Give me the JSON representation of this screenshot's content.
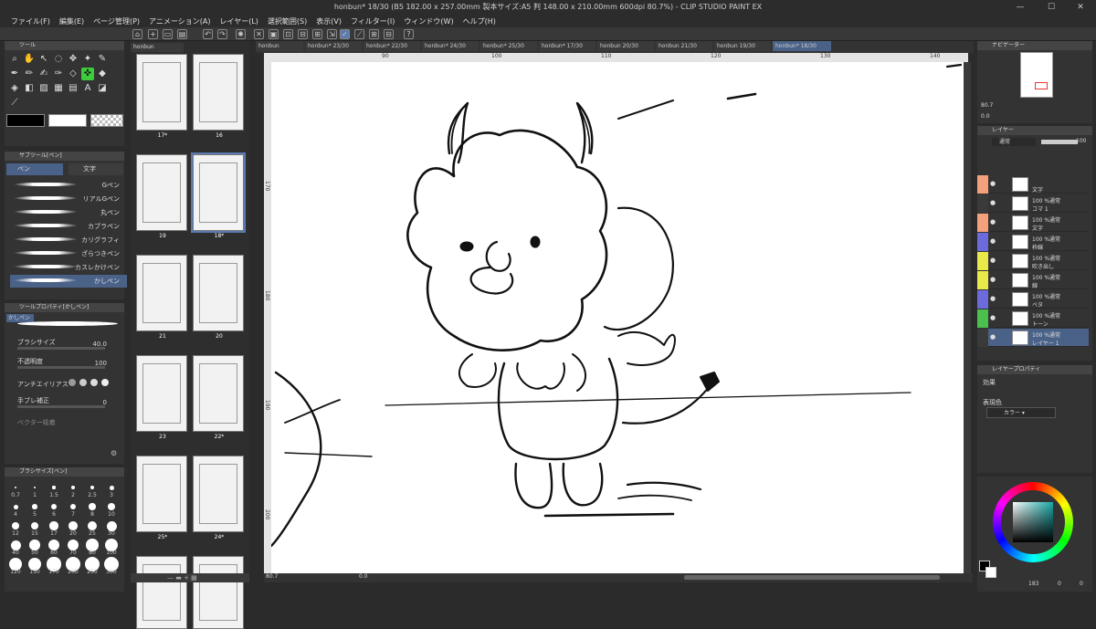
{
  "window": {
    "title": "honbun* 18/30 (B5 182.00 x 257.00mm 製本サイズ:A5 判 148.00 x 210.00mm 600dpi 80.7%) - CLIP STUDIO PAINT EX",
    "minimize": "—",
    "maximize": "☐",
    "close": "✕"
  },
  "menu": [
    "ファイル(F)",
    "編集(E)",
    "ページ管理(P)",
    "アニメーション(A)",
    "レイヤー(L)",
    "選択範囲(S)",
    "表示(V)",
    "フィルター(I)",
    "ウィンドウ(W)",
    "ヘルプ(H)"
  ],
  "tool_panel": {
    "title": "ツール"
  },
  "subtool": {
    "title": "サブツール[ペン]",
    "group1": "ペン",
    "group2": "文字",
    "brushes": [
      "Gペン",
      "リアルGペン",
      "丸ペン",
      "カブラペン",
      "カリグラフィ",
      "ざらつきペン",
      "カスレかけペン",
      "かしペン"
    ]
  },
  "tool_property": {
    "title": "ツールプロパティ[かしペン]",
    "name": "かしペン",
    "brush_size_label": "ブラシサイズ",
    "brush_size_value": "40.0",
    "opacity_label": "不透明度",
    "opacity_value": "100",
    "antialias_label": "アンチエイリアス",
    "stabilization_label": "手ブレ補正",
    "stabilization_value": "0",
    "vector_label": "ベクター吸着"
  },
  "brush_size_panel": {
    "title": "ブラシサイズ[ペン]",
    "sizes": [
      "0.7",
      "1",
      "1.5",
      "2",
      "2.5",
      "3",
      "4",
      "5",
      "6",
      "7",
      "8",
      "10",
      "12",
      "15",
      "17",
      "20",
      "25",
      "30",
      "40",
      "50",
      "60",
      "70",
      "80",
      "100",
      "120",
      "150",
      "170",
      "200",
      "250",
      "300"
    ]
  },
  "page_panel": {
    "tab": "honbun",
    "pages": [
      {
        "label": "17*",
        "num": "16"
      },
      {
        "label": "19",
        "num": "18*"
      },
      {
        "label": "21",
        "num": "20"
      },
      {
        "label": "23",
        "num": "22*"
      },
      {
        "label": "25*",
        "num": "24*"
      },
      {
        "label": "",
        "num": ""
      }
    ]
  },
  "tabs": [
    {
      "label": "honbun",
      "active": false
    },
    {
      "label": "honbun* 23/30",
      "active": false
    },
    {
      "label": "honbun* 22/30",
      "active": false
    },
    {
      "label": "honbun* 24/30",
      "active": false
    },
    {
      "label": "honbun* 25/30",
      "active": false
    },
    {
      "label": "honbun* 17/30",
      "active": false
    },
    {
      "label": "honbun 20/30",
      "active": false
    },
    {
      "label": "honbun 21/30",
      "active": false
    },
    {
      "label": "honbun 19/30",
      "active": false
    },
    {
      "label": "honbun* 18/30",
      "active": true
    }
  ],
  "ruler_top": [
    "90",
    "100",
    "110",
    "120",
    "130",
    "140"
  ],
  "ruler_left": [
    "170",
    "180",
    "190",
    "200"
  ],
  "status": {
    "zoom": "80.7",
    "angle": "0.0"
  },
  "navigator": {
    "title": "ナビゲーター",
    "zoom": "80.7",
    "angle": "0.0"
  },
  "layer_panel": {
    "title": "レイヤー",
    "blend": "通常",
    "opacity": "100",
    "layers": [
      {
        "top": "",
        "name": "文字",
        "color": "#f4a07a"
      },
      {
        "top": "100 %通常",
        "name": "コマ 1",
        "color": "#3a3a3a"
      },
      {
        "top": "100 %通常",
        "name": "文字",
        "color": "#f4a07a"
      },
      {
        "top": "100 %通常",
        "name": "枠線",
        "color": "#6b6bdc"
      },
      {
        "top": "100 %通常",
        "name": "吹き出し",
        "color": "#e8e84a"
      },
      {
        "top": "100 %通常",
        "name": "線",
        "color": "#e8e84a"
      },
      {
        "top": "100 %通常",
        "name": "ベタ",
        "color": "#6b6bdc"
      },
      {
        "top": "100 %通常",
        "name": "トーン",
        "color": "#4cc04c"
      },
      {
        "top": "100 %通常",
        "name": "レイヤー 1",
        "color": "#3a3a3a"
      }
    ]
  },
  "layer_property": {
    "title": "レイヤープロパティ",
    "effect_label": "効果",
    "color_label": "表現色",
    "color_value": "カラー"
  },
  "color_wheel": {
    "value1": "183",
    "value2": "0",
    "value3": "0"
  }
}
